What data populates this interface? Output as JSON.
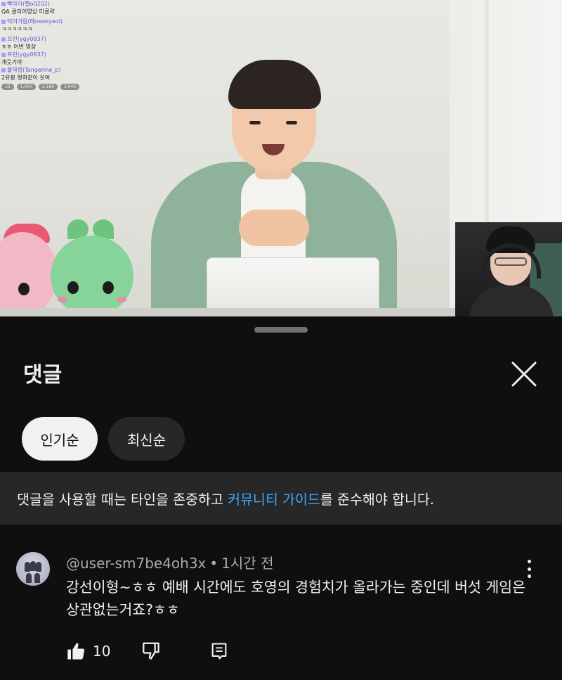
{
  "video": {
    "chat": [
      {
        "nick": "빡아이(빨o0202)",
        "msg": ""
      },
      {
        "nick": "",
        "msg": "QA 클리어영상 미클략"
      },
      {
        "nick": "",
        "msg": ""
      },
      {
        "nick": "덕이가람(메neokyeol)",
        "msg": ""
      },
      {
        "nick": "",
        "msg": "ㅋㅋㅋㅋㅋㅋ"
      },
      {
        "nick": "",
        "msg": ""
      },
      {
        "nick": "프린(ygy0837)",
        "msg": ""
      },
      {
        "nick": "",
        "msg": "ㅎㅎ 이번 영상"
      },
      {
        "nick": "프린(ygy0837)",
        "msg": ""
      },
      {
        "nick": "",
        "msg": "개웃기야"
      },
      {
        "nick": "물약컵(Tangerine_p)",
        "msg": ""
      },
      {
        "nick": "",
        "msg": "2유팡 형혀같이 웃여"
      }
    ],
    "chat_stats": [
      "12",
      "1,400",
      "2,180",
      "3,040"
    ]
  },
  "panel": {
    "title": "댓글",
    "close_label": "close"
  },
  "filters": {
    "popular": "인기순",
    "newest": "최신순"
  },
  "guide": {
    "before": "댓글을 사용할 때는 타인을 존중하고 ",
    "link": "커뮤니티 가이드",
    "after": "를 준수해야 합니다."
  },
  "comment": {
    "author": "@user-sm7be4oh3x",
    "separator": "•",
    "time": "1시간 전",
    "text": "강선이형~ㅎㅎ 예배 시간에도 호영의 경험치가 올라가는 중인데 버섯 게임은 상관없는거죠?ㅎㅎ",
    "likes": "10"
  },
  "colors": {
    "background": "#0f0f0f",
    "chip_active": "#f1f1f1",
    "chip_inactive": "#272727",
    "link": "#3ea6ff",
    "meta": "#aaaaaa"
  },
  "icons": [
    "close-icon",
    "like-icon",
    "dislike-icon",
    "reply-icon",
    "more-vert-icon"
  ]
}
